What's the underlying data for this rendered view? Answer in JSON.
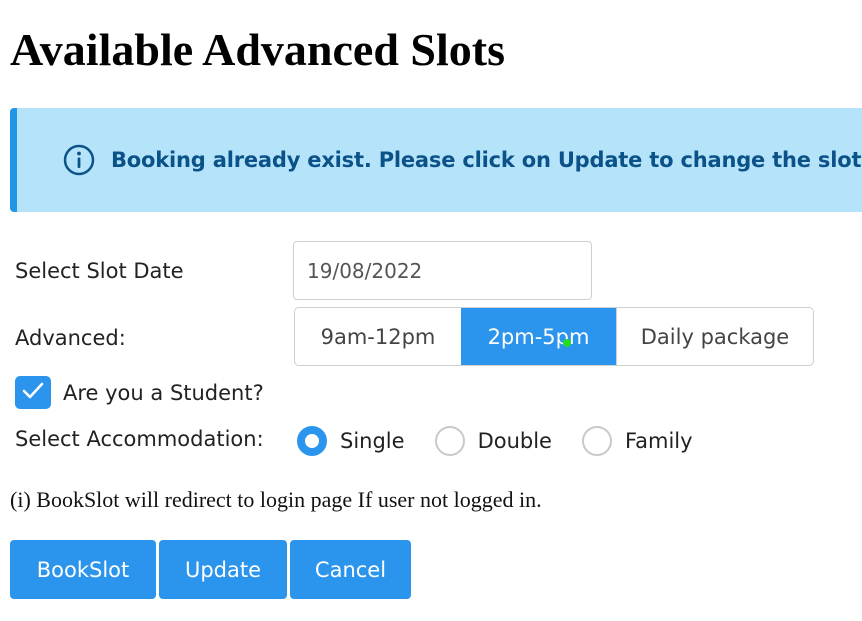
{
  "page": {
    "title": "Available Advanced Slots"
  },
  "alert": {
    "icon": "info-circle-icon",
    "message": "Booking already exist. Please click on Update to change the slot.",
    "background_color": "#b5e4fa",
    "accent_color": "#1f96e6",
    "text_color": "#0b5289"
  },
  "slot_date": {
    "label": "Select Slot Date",
    "value": "19/08/2022"
  },
  "advanced": {
    "label": "Advanced:",
    "options": [
      {
        "label": "9am-12pm",
        "selected": false
      },
      {
        "label": "2pm-5pm",
        "selected": true
      },
      {
        "label": "Daily package",
        "selected": false
      }
    ]
  },
  "student": {
    "label": "Are you a Student?",
    "checked": true
  },
  "accommodation": {
    "label": "Select Accommodation:",
    "options": [
      {
        "label": "Single",
        "checked": true
      },
      {
        "label": "Double",
        "checked": false
      },
      {
        "label": "Family",
        "checked": false
      }
    ]
  },
  "note": "(i) BookSlot will redirect to login page If user not logged in.",
  "buttons": {
    "bookslot": "BookSlot",
    "update": "Update",
    "cancel": "Cancel"
  },
  "colors": {
    "primary": "#2b94ec"
  }
}
